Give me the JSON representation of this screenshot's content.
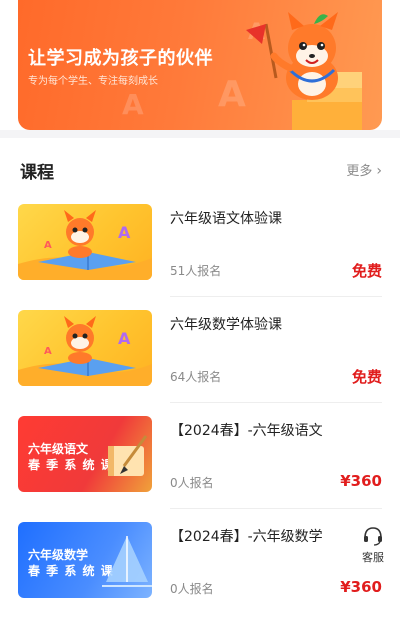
{
  "banner": {
    "title": "让学习成为孩子的伙伴",
    "subtitle": "专为每个学生、专注每刻成长"
  },
  "section": {
    "title": "课程",
    "more_label": "更多"
  },
  "courses": [
    {
      "title": "六年级语文体验课",
      "enrolled": "51人报名",
      "price": "免费",
      "thumb_style": "mascot-yellow"
    },
    {
      "title": "六年级数学体验课",
      "enrolled": "64人报名",
      "price": "免费",
      "thumb_style": "mascot-yellow"
    },
    {
      "title": "【2024春】-六年级语文",
      "enrolled": "0人报名",
      "price": "¥360",
      "thumb_style": "red",
      "thumb_text": [
        "六年级语文",
        "春 季 系 统 课"
      ]
    },
    {
      "title": "【2024春】-六年级数学",
      "enrolled": "0人报名",
      "price": "¥360",
      "thumb_style": "blue",
      "thumb_text": [
        "六年级数学",
        "春 季 系 统 课"
      ]
    }
  ],
  "support": {
    "label": "客服",
    "icon": "headset-icon"
  },
  "colors": {
    "banner_orange": "#ff6a2a",
    "price_red": "#e11d1d"
  }
}
